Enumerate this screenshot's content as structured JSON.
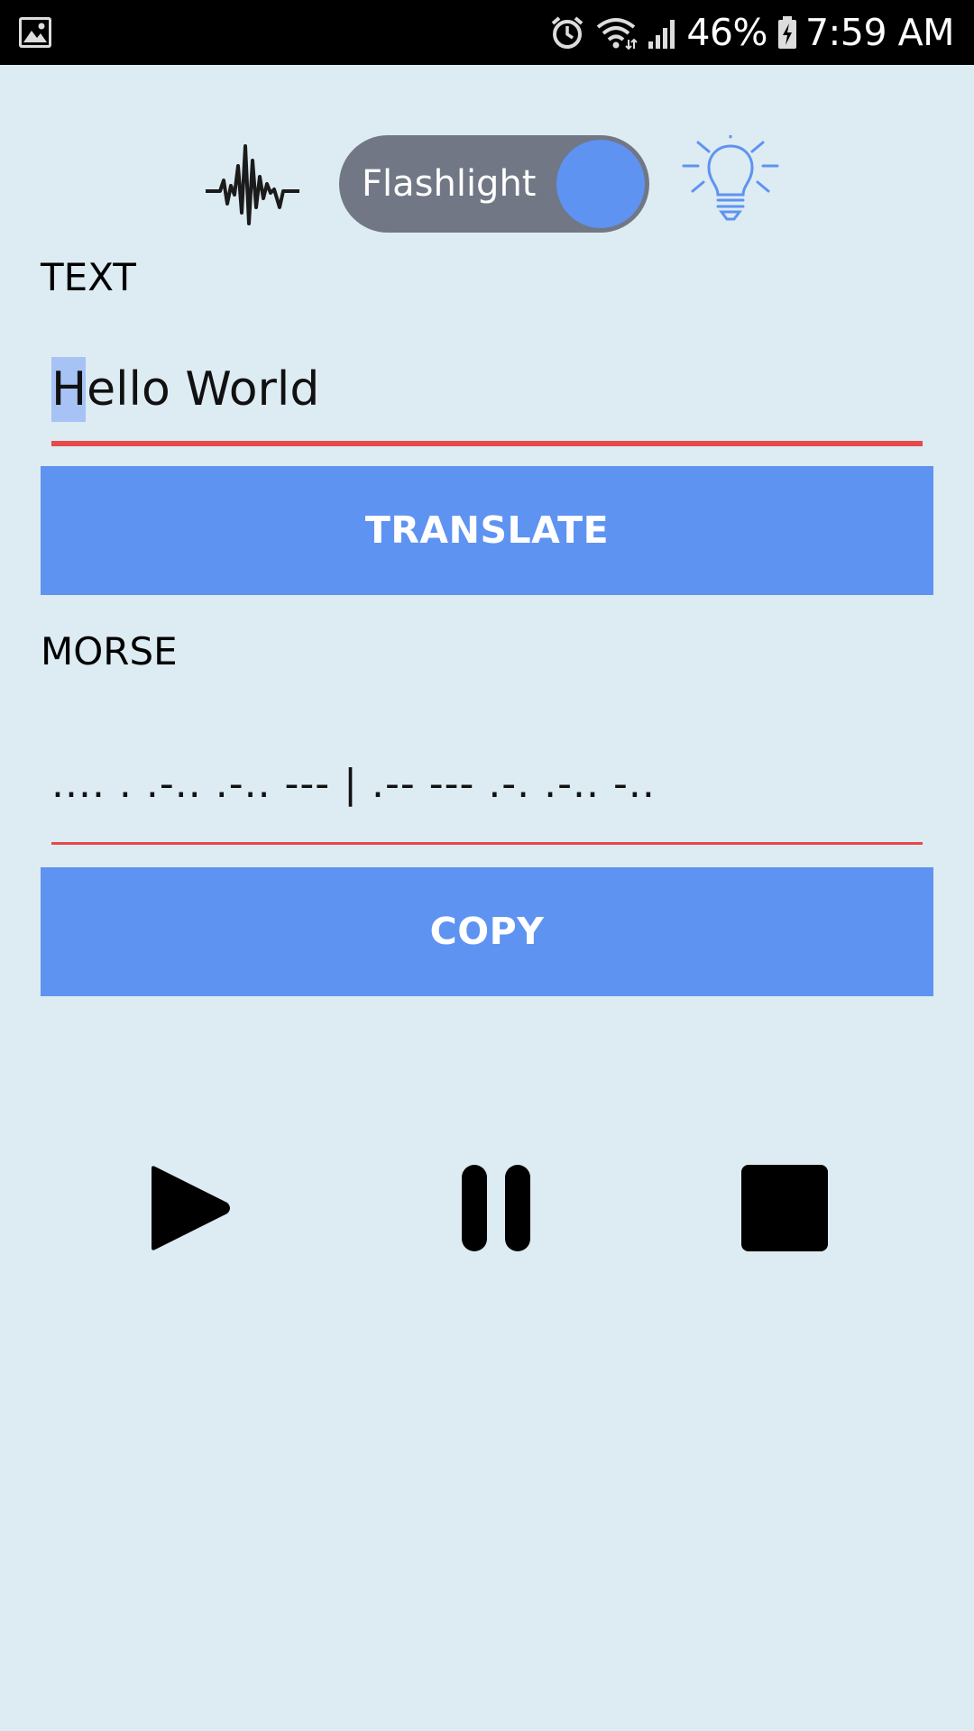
{
  "status_bar": {
    "icons": [
      "gallery-icon",
      "alarm-icon",
      "wifi-icon",
      "signal-icon",
      "battery-charging-icon"
    ],
    "battery": "46%",
    "time": "7:59 AM"
  },
  "top_controls": {
    "wave_icon": "waveform-icon",
    "flashlight_toggle": {
      "label": "Flashlight",
      "state": "on"
    },
    "bulb_icon": "lightbulb-icon"
  },
  "text_section": {
    "label": "TEXT",
    "input_value": "Hello World",
    "selected_text": "H"
  },
  "translate_button": {
    "label": "TRANSLATE"
  },
  "morse_section": {
    "label": "MORSE",
    "output_value": ".... . .-.. .-.. --- | .-- --- .-. .-.. -.."
  },
  "copy_button": {
    "label": "COPY"
  },
  "playback": {
    "controls": [
      "play-icon",
      "pause-icon",
      "stop-icon"
    ]
  },
  "colors": {
    "background": "#ddebf2",
    "accent": "#5f93f1",
    "toggle_track": "#717785",
    "underline": "#e54a4a",
    "status_bar": "#000000"
  }
}
